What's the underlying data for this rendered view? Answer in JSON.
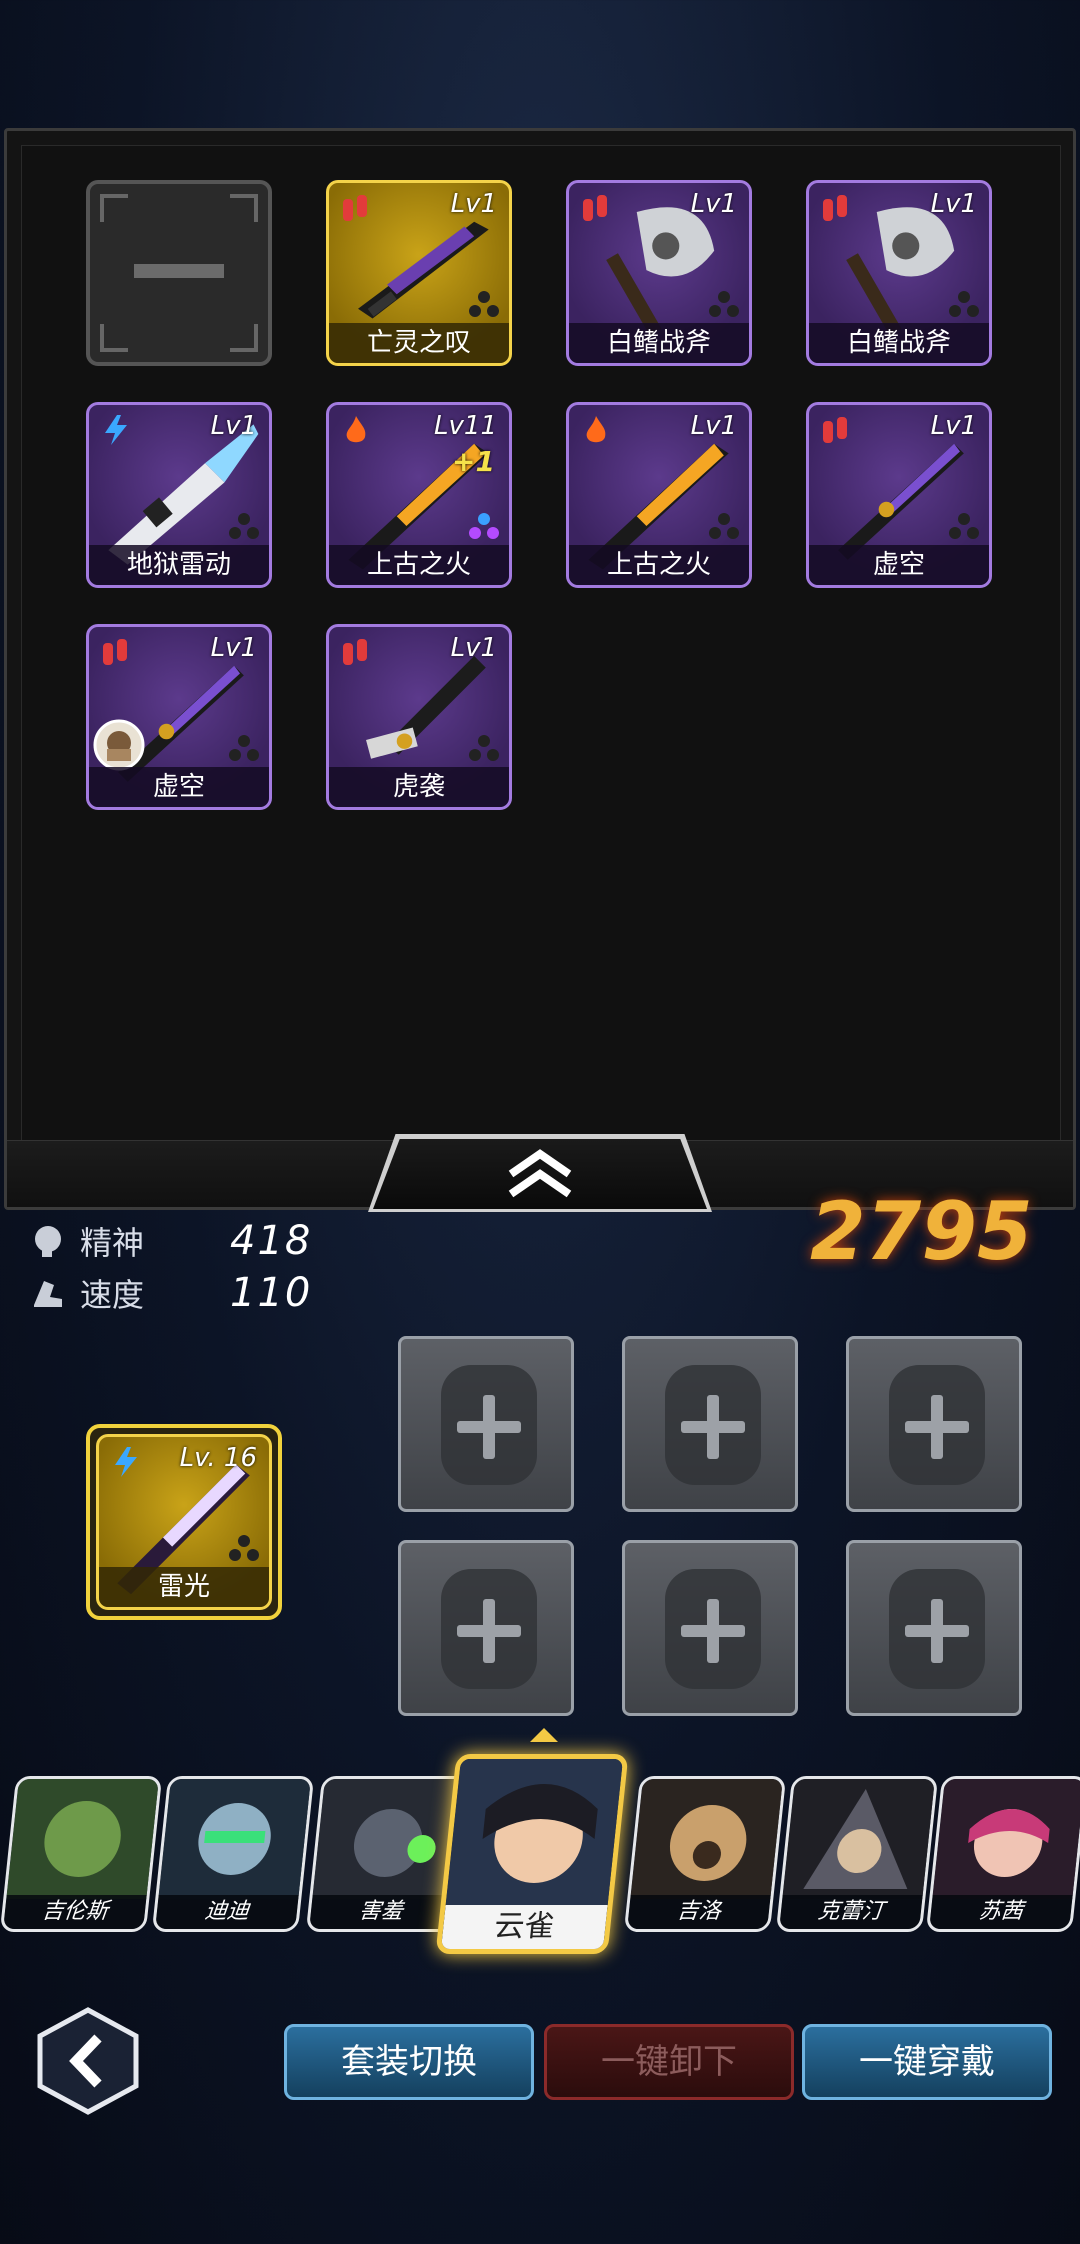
{
  "inventory": {
    "items": [
      {
        "name": "",
        "level": "",
        "kind": "empty",
        "tier": "empty"
      },
      {
        "name": "亡灵之叹",
        "level": "Lv1",
        "kind": "ammo",
        "tier": "gold"
      },
      {
        "name": "白鳍战斧",
        "level": "Lv1",
        "kind": "ammo",
        "tier": "purple"
      },
      {
        "name": "白鳍战斧",
        "level": "Lv1",
        "kind": "ammo",
        "tier": "purple"
      },
      {
        "name": "地狱雷动",
        "level": "Lv1",
        "kind": "lightning",
        "tier": "purple"
      },
      {
        "name": "上古之火",
        "level": "Lv11",
        "plus": "+1",
        "kind": "fire",
        "tier": "purple"
      },
      {
        "name": "上古之火",
        "level": "Lv1",
        "kind": "fire",
        "tier": "purple"
      },
      {
        "name": "虚空",
        "level": "Lv1",
        "kind": "ammo",
        "tier": "purple"
      },
      {
        "name": "虚空",
        "level": "Lv1",
        "kind": "ammo",
        "tier": "purple"
      },
      {
        "name": "虎袭",
        "level": "Lv1",
        "kind": "ammo",
        "tier": "purple"
      }
    ]
  },
  "stats": [
    {
      "label": "精神",
      "value": "418",
      "icon": "brain-icon"
    },
    {
      "label": "速度",
      "value": "110",
      "icon": "boot-icon"
    }
  ],
  "power": "2795",
  "equipped_weapon": {
    "name": "雷光",
    "level": "Lv. 16",
    "kind": "lightning"
  },
  "heroes": [
    "吉伦斯",
    "迪迪",
    "害羞",
    "云雀",
    "吉洛",
    "克蕾汀",
    "苏茜"
  ],
  "selected_hero": "云雀",
  "buttons": {
    "switch_set": "套装切换",
    "unequip_all": "一键卸下",
    "equip_all": "一键穿戴"
  },
  "colors": {
    "purple_tier": "#a37be0",
    "gold_tier": "#f4d34a",
    "button_blue": "#2b6f9e"
  }
}
